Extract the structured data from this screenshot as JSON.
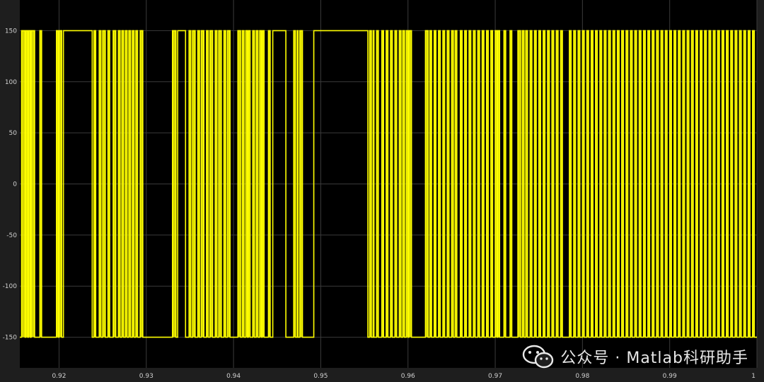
{
  "window": {
    "background": "#1e1e1e",
    "plot_background": "#000000",
    "grid_color": "#3a3a3a",
    "trace_color": "#ffff00"
  },
  "watermark": {
    "text": "公众号 · Matlab科研助手",
    "icon": "wechat-logo-icon"
  },
  "chart_data": {
    "type": "line",
    "title": "",
    "xlabel": "",
    "ylabel": "",
    "xlim": [
      0.9155,
      1.0
    ],
    "ylim": [
      -180,
      180
    ],
    "grid": true,
    "x_ticks": [
      0.92,
      0.93,
      0.94,
      0.95,
      0.96,
      0.97,
      0.98,
      0.99,
      1
    ],
    "x_tick_labels": [
      "0.92",
      "0.93",
      "0.94",
      "0.95",
      "0.96",
      "0.97",
      "0.98",
      "0.99",
      "1"
    ],
    "y_ticks": [
      150,
      100,
      50,
      0,
      -50,
      -100,
      -150
    ],
    "y_tick_labels": [
      "150",
      "100",
      "50",
      "0",
      "-50",
      "-100",
      "-150"
    ],
    "series": [
      {
        "color": "#ffff00",
        "levels": [
          -150,
          150
        ],
        "high_intervals": [
          [
            0.9157,
            0.9161
          ],
          [
            0.9162,
            0.9164
          ],
          [
            0.9165,
            0.9167
          ],
          [
            0.9168,
            0.9172
          ],
          [
            0.9178,
            0.918
          ],
          [
            0.9197,
            0.9199
          ],
          [
            0.92,
            0.9203
          ],
          [
            0.9205,
            0.9238
          ],
          [
            0.924,
            0.9242
          ],
          [
            0.9246,
            0.9248
          ],
          [
            0.925,
            0.9253
          ],
          [
            0.9256,
            0.9258
          ],
          [
            0.9262,
            0.9265
          ],
          [
            0.9268,
            0.927
          ],
          [
            0.9272,
            0.9274
          ],
          [
            0.9276,
            0.9278
          ],
          [
            0.928,
            0.9282
          ],
          [
            0.9284,
            0.9286
          ],
          [
            0.9288,
            0.929
          ],
          [
            0.9293,
            0.9296
          ],
          [
            0.933,
            0.9334
          ],
          [
            0.9336,
            0.9345
          ],
          [
            0.9349,
            0.9351
          ],
          [
            0.9353,
            0.9356
          ],
          [
            0.9359,
            0.9361
          ],
          [
            0.9363,
            0.9366
          ],
          [
            0.9369,
            0.9371
          ],
          [
            0.9373,
            0.9376
          ],
          [
            0.9379,
            0.9381
          ],
          [
            0.9383,
            0.9386
          ],
          [
            0.9389,
            0.9391
          ],
          [
            0.9393,
            0.9396
          ],
          [
            0.9405,
            0.9408
          ],
          [
            0.941,
            0.9412
          ],
          [
            0.9414,
            0.9416
          ],
          [
            0.9417,
            0.9419
          ],
          [
            0.9422,
            0.9424
          ],
          [
            0.9426,
            0.9428
          ],
          [
            0.943,
            0.9432
          ],
          [
            0.9433,
            0.9435
          ],
          [
            0.944,
            0.9442
          ],
          [
            0.9445,
            0.946
          ],
          [
            0.9469,
            0.9471
          ],
          [
            0.9473,
            0.9474
          ],
          [
            0.9476,
            0.9479
          ],
          [
            0.9492,
            0.9554
          ],
          [
            0.9556,
            0.9558
          ],
          [
            0.956,
            0.9561
          ],
          [
            0.9564,
            0.9566
          ],
          [
            0.957,
            0.9572
          ],
          [
            0.9575,
            0.9577
          ],
          [
            0.958,
            0.9582
          ],
          [
            0.9585,
            0.9587
          ],
          [
            0.959,
            0.9592
          ],
          [
            0.9594,
            0.9596
          ],
          [
            0.9598,
            0.96
          ],
          [
            0.9601,
            0.9604
          ],
          [
            0.962,
            0.9623
          ],
          [
            0.9625,
            0.9627
          ],
          [
            0.963,
            0.9632
          ],
          [
            0.9635,
            0.9637
          ],
          [
            0.964,
            0.9642
          ],
          [
            0.9645,
            0.9647
          ],
          [
            0.965,
            0.9652
          ],
          [
            0.9654,
            0.9656
          ],
          [
            0.966,
            0.9662
          ],
          [
            0.9665,
            0.9667
          ],
          [
            0.967,
            0.9672
          ],
          [
            0.9675,
            0.9677
          ],
          [
            0.968,
            0.9682
          ],
          [
            0.9685,
            0.9687
          ],
          [
            0.969,
            0.9692
          ],
          [
            0.9695,
            0.9697
          ],
          [
            0.97,
            0.9702
          ],
          [
            0.9703,
            0.9705
          ],
          [
            0.971,
            0.9712
          ],
          [
            0.9717,
            0.9719
          ],
          [
            0.9726,
            0.9729
          ],
          [
            0.9731,
            0.9733
          ],
          [
            0.9735,
            0.9737
          ],
          [
            0.974,
            0.9742
          ],
          [
            0.9745,
            0.9747
          ],
          [
            0.975,
            0.9752
          ],
          [
            0.9755,
            0.9757
          ],
          [
            0.976,
            0.9762
          ],
          [
            0.9765,
            0.9767
          ],
          [
            0.977,
            0.9772
          ],
          [
            0.9775,
            0.9777
          ],
          [
            0.9785,
            0.9787
          ],
          [
            0.979,
            0.9792
          ],
          [
            0.9795,
            0.9797
          ],
          [
            0.98,
            0.9802
          ],
          [
            0.9805,
            0.9807
          ],
          [
            0.981,
            0.9812
          ],
          [
            0.9815,
            0.9817
          ],
          [
            0.982,
            0.9822
          ],
          [
            0.9825,
            0.9827
          ],
          [
            0.983,
            0.9832
          ],
          [
            0.9835,
            0.9837
          ],
          [
            0.984,
            0.9842
          ],
          [
            0.9845,
            0.9847
          ],
          [
            0.985,
            0.9852
          ],
          [
            0.9855,
            0.9857
          ],
          [
            0.986,
            0.9862
          ],
          [
            0.9865,
            0.9867
          ],
          [
            0.987,
            0.9872
          ],
          [
            0.9875,
            0.9877
          ],
          [
            0.988,
            0.9882
          ],
          [
            0.9885,
            0.9887
          ],
          [
            0.989,
            0.9892
          ],
          [
            0.9895,
            0.9897
          ],
          [
            0.99,
            0.9902
          ],
          [
            0.9905,
            0.9907
          ],
          [
            0.991,
            0.9912
          ],
          [
            0.9915,
            0.9917
          ],
          [
            0.992,
            0.9922
          ],
          [
            0.9925,
            0.9927
          ],
          [
            0.993,
            0.9932
          ],
          [
            0.9935,
            0.9937
          ],
          [
            0.994,
            0.9942
          ],
          [
            0.9945,
            0.9947
          ],
          [
            0.995,
            0.9952
          ],
          [
            0.9955,
            0.9957
          ],
          [
            0.996,
            0.9962
          ],
          [
            0.9965,
            0.9967
          ],
          [
            0.997,
            0.9972
          ],
          [
            0.9975,
            0.9977
          ],
          [
            0.998,
            0.9982
          ],
          [
            0.9985,
            0.9987
          ],
          [
            0.999,
            0.9992
          ],
          [
            0.9995,
            0.9997
          ]
        ]
      }
    ]
  }
}
